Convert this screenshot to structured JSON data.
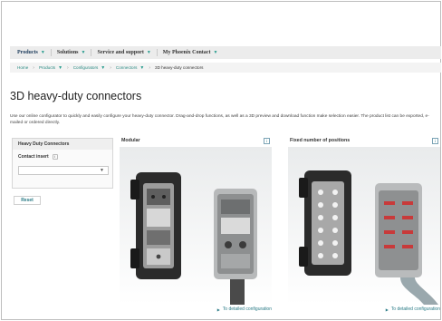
{
  "nav": {
    "items": [
      {
        "label": "Products",
        "active": true
      },
      {
        "label": "Solutions",
        "active": false
      },
      {
        "label": "Service and support",
        "active": false
      },
      {
        "label": "My Phoenix Contact",
        "active": false
      }
    ],
    "chevron": "▼"
  },
  "breadcrumb": {
    "items": [
      {
        "label": "Home",
        "dropdown": false
      },
      {
        "label": "Products",
        "dropdown": true
      },
      {
        "label": "Configurators",
        "dropdown": true
      },
      {
        "label": "Connectors",
        "dropdown": true
      },
      {
        "label": "3D heavy-duty connectors",
        "dropdown": false
      }
    ],
    "separator": "›"
  },
  "page": {
    "title": "3D heavy-duty connectors",
    "intro": "Use our online configurator to quickly and easily configure your heavy-duty connector. Drag-and-drop functions, as well as a 3D preview and download function make selection easier. The product list can be exported, e-mailed or ordered directly."
  },
  "filter": {
    "heading": "Heavy Duty Connectors",
    "contact_insert_label": "Contact insert",
    "info_glyph": "i",
    "select_value": "",
    "select_arrow": "▼",
    "reset_label": "Reset"
  },
  "cards": [
    {
      "title": "Modular",
      "info_glyph": "i",
      "link_label": "To detailed configuration",
      "link_glyph": "▶"
    },
    {
      "title": "Fixed number of positions",
      "info_glyph": "i",
      "link_label": "To detailed configuration",
      "link_glyph": "▶"
    }
  ],
  "colors": {
    "accent": "#2a7b86",
    "nav_bg": "#ececec",
    "breadcrumb_bg": "#f3f3f3"
  }
}
